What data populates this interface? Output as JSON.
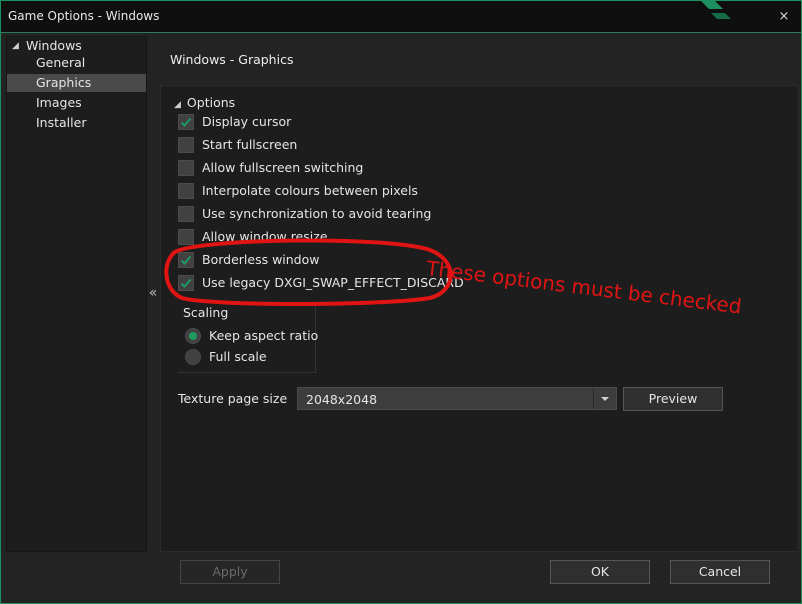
{
  "window": {
    "title": "Game Options - Windows",
    "accent_color": "#1e8f5e"
  },
  "titlebar_buttons": {
    "close": "×"
  },
  "sidebar": {
    "items": [
      {
        "label": "Windows",
        "expanded": true
      },
      {
        "label": "General"
      },
      {
        "label": "Graphics",
        "selected": true
      },
      {
        "label": "Images"
      },
      {
        "label": "Installer"
      }
    ],
    "collapse_glyph": "«"
  },
  "main": {
    "heading": "Windows - Graphics",
    "options_section": {
      "title": "Options",
      "items": [
        {
          "label": "Display cursor",
          "checked": true
        },
        {
          "label": "Start fullscreen",
          "checked": false
        },
        {
          "label": "Allow fullscreen switching",
          "checked": false
        },
        {
          "label": "Interpolate colours between pixels",
          "checked": false
        },
        {
          "label": "Use synchronization to avoid tearing",
          "checked": false
        },
        {
          "label": "Allow window resize",
          "checked": false
        },
        {
          "label": "Borderless window",
          "checked": true
        },
        {
          "label": "Use legacy DXGI_SWAP_EFFECT_DISCARD",
          "checked": true
        }
      ]
    },
    "scaling": {
      "title": "Scaling",
      "options": [
        {
          "label": "Keep aspect ratio",
          "selected": true
        },
        {
          "label": "Full scale",
          "selected": false
        }
      ]
    },
    "texture_page": {
      "label": "Texture page size",
      "value": "2048x2048",
      "preview_label": "Preview"
    }
  },
  "annotation": {
    "text": "These options must be checked",
    "color": "#e11414"
  },
  "footer": {
    "apply_label": "Apply",
    "ok_label": "OK",
    "cancel_label": "Cancel"
  },
  "check_color": "#1e9a62"
}
